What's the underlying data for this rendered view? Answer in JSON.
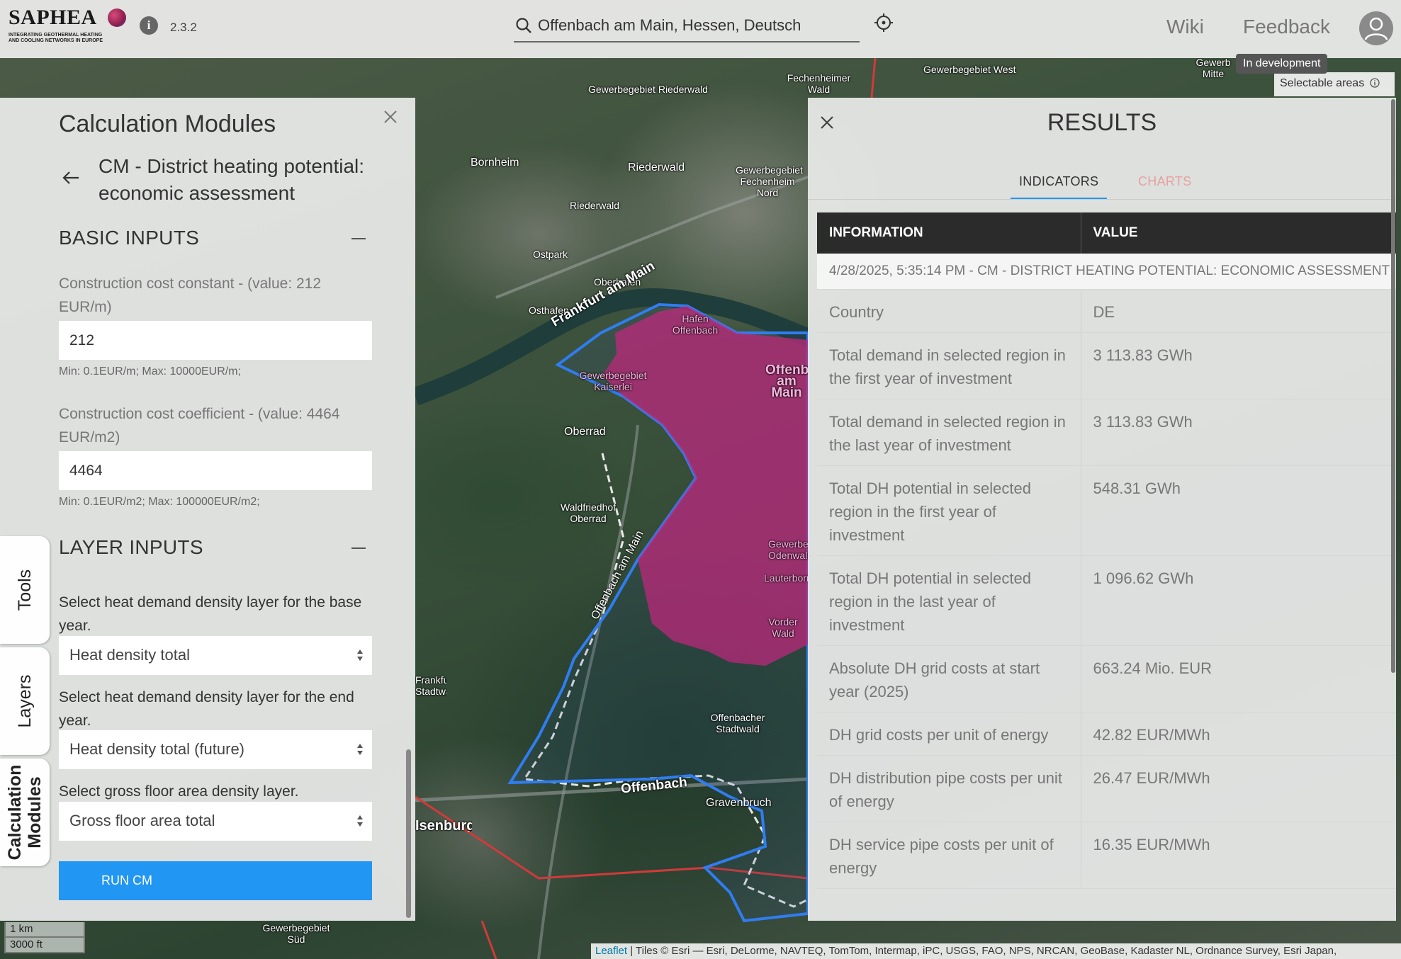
{
  "app": {
    "logo_word": "SAPHEA",
    "logo_tagline_1": "INTEGRATING GEOTHERMAL HEATING",
    "logo_tagline_2": "AND COOLING NETWORKS IN EUROPE",
    "version": "2.3.2",
    "info_icon_glyph": "i"
  },
  "search": {
    "value": "Offenbach am Main, Hessen, Deutsch",
    "icon": "search-icon"
  },
  "nav": {
    "wiki": "Wiki",
    "feedback": "Feedback",
    "tooltip": "In development"
  },
  "map": {
    "selectable_areas": "Selectable areas",
    "labels": [
      "Gewerbegebiet Riederwald",
      "Bornheim",
      "Riederwald",
      "Gewerbegebiet Fechenheim Nord",
      "Fechenheimer Wald",
      "Gewerbegebiet West",
      "Riederwald",
      "Ostpark",
      "Oberhafen",
      "Osthafen",
      "Frankfurt am Main",
      "Hafen Offenbach",
      "Gewerbegebiet Kaiserlei",
      "Offenbach am Main",
      "Oberrad",
      "Waldfriedhof Oberrad",
      "Offenbach am Main",
      "Gewerbegebiet Odenwald",
      "Lauterborn",
      "Vorder Wald",
      "Offenbacher Stadtwald",
      "Offenbach",
      "Gravenbruch",
      "Isenburg",
      "Frankfurter Stadtwald",
      "Gewerbegebiet Süd",
      "Gewerb Mitte"
    ],
    "scale_km": "1 km",
    "scale_ft": "3000 ft",
    "attribution_leaflet": "Leaflet",
    "attribution_text": " | Tiles © Esri — Esri, DeLorme, NAVTEQ, TomTom, Intermap, iPC, USGS, FAO, NPS, NRCAN, GeoBase, Kadaster NL, Ordnance Survey, Esri Japan,",
    "colors": {
      "selection_fill": "#c2277e",
      "selection_outline": "#2f7df0",
      "boundary": "#d23a3a"
    }
  },
  "left_panel": {
    "title": "Calculation Modules",
    "module_name": "CM - District heating potential: economic assessment",
    "basic_inputs": {
      "heading": "BASIC INPUTS",
      "fields": [
        {
          "label": "Construction cost constant - (value: 212 EUR/m)",
          "value": "212",
          "hint": "Min: 0.1EUR/m; Max: 10000EUR/m;"
        },
        {
          "label": "Construction cost coefficient - (value: 4464 EUR/m2)",
          "value": "4464",
          "hint": "Min: 0.1EUR/m2; Max: 100000EUR/m2;"
        }
      ]
    },
    "layer_inputs": {
      "heading": "LAYER INPUTS",
      "selects": [
        {
          "label": "Select heat demand density layer for the base year.",
          "value": "Heat density total"
        },
        {
          "label": "Select heat demand density layer for the end year.",
          "value": "Heat density total (future)"
        },
        {
          "label": "Select gross floor area density layer.",
          "value": "Gross floor area total"
        }
      ]
    },
    "run_button": "RUN CM"
  },
  "side_tabs": {
    "tools": "Tools",
    "layers": "Layers",
    "calc_line1": "Calculation",
    "calc_line2": "Modules"
  },
  "results": {
    "title": "RESULTS",
    "tabs": [
      "INDICATORS",
      "CHARTS"
    ],
    "columns": [
      "INFORMATION",
      "VALUE"
    ],
    "stamp": "4/28/2025, 5:35:14 PM - CM - DISTRICT HEATING POTENTIAL: ECONOMIC ASSESSMENT",
    "rows": [
      {
        "info": "Country",
        "value": "DE"
      },
      {
        "info": "Total demand in selected region in the first year of investment",
        "value": "3 113.83 GWh"
      },
      {
        "info": "Total demand in selected region in the last year of investment",
        "value": "3 113.83 GWh"
      },
      {
        "info": "Total DH potential in selected region in the first year of investment",
        "value": "548.31 GWh"
      },
      {
        "info": "Total DH potential in selected region in the last year of investment",
        "value": "1 096.62 GWh"
      },
      {
        "info": "Absolute DH grid costs at start year (2025)",
        "value": "663.24 Mio. EUR"
      },
      {
        "info": "DH grid costs per unit of energy",
        "value": "42.82 EUR/MWh"
      },
      {
        "info": "DH distribution pipe costs per unit of energy",
        "value": "26.47 EUR/MWh"
      },
      {
        "info": "DH service pipe costs per unit of energy",
        "value": "16.35 EUR/MWh"
      }
    ],
    "accent_color": "#2196f3"
  }
}
